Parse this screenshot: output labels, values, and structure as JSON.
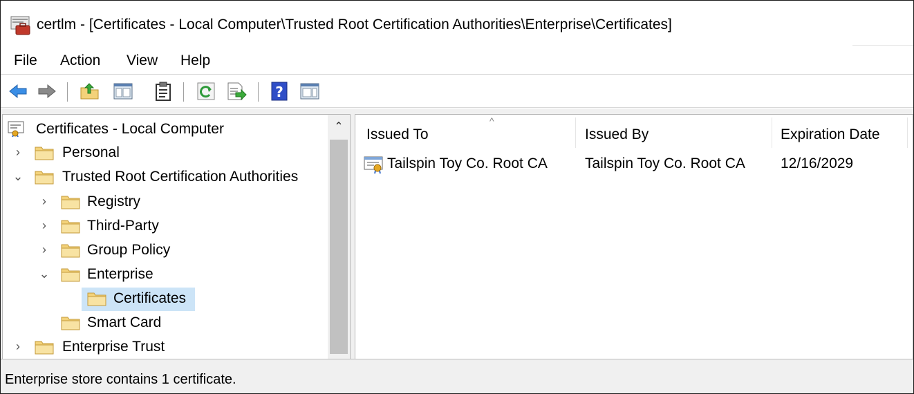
{
  "window": {
    "title": "certlm - [Certificates - Local Computer\\Trusted Root Certification Authorities\\Enterprise\\Certificates]"
  },
  "menu": {
    "items": [
      "File",
      "Action",
      "View",
      "Help"
    ]
  },
  "toolbar": {
    "icons": [
      "back-arrow-icon",
      "forward-arrow-icon",
      "up-folder-icon",
      "show-hide-console-tree-icon",
      "properties-clipboard-icon",
      "refresh-icon",
      "export-list-icon",
      "help-icon",
      "action-pane-icon"
    ]
  },
  "tree": {
    "items": [
      {
        "label": "Certificates - Local Computer",
        "expander": ""
      },
      {
        "label": "Personal",
        "expander": "›"
      },
      {
        "label": "Trusted Root Certification Authorities",
        "expander": "⌄"
      },
      {
        "label": "Registry",
        "expander": "›"
      },
      {
        "label": "Third-Party",
        "expander": "›"
      },
      {
        "label": "Group Policy",
        "expander": "›"
      },
      {
        "label": "Enterprise",
        "expander": "⌄"
      },
      {
        "label": "Certificates",
        "expander": ""
      },
      {
        "label": "Smart Card",
        "expander": ""
      },
      {
        "label": "Enterprise Trust",
        "expander": "›"
      }
    ],
    "selected": "Certificates"
  },
  "list": {
    "columns": [
      "Issued To",
      "Issued By",
      "Expiration Date"
    ],
    "sort_indicator": "^",
    "rows": [
      {
        "issued_to": "Tailspin Toy Co. Root CA",
        "issued_by": "Tailspin Toy Co. Root CA",
        "expiration": "12/16/2029"
      }
    ]
  },
  "status": {
    "text": "Enterprise store contains 1 certificate."
  },
  "colors": {
    "selection": "#cce4f7",
    "folder": "#f3d27a",
    "pane_background": "#f0f0f0"
  }
}
